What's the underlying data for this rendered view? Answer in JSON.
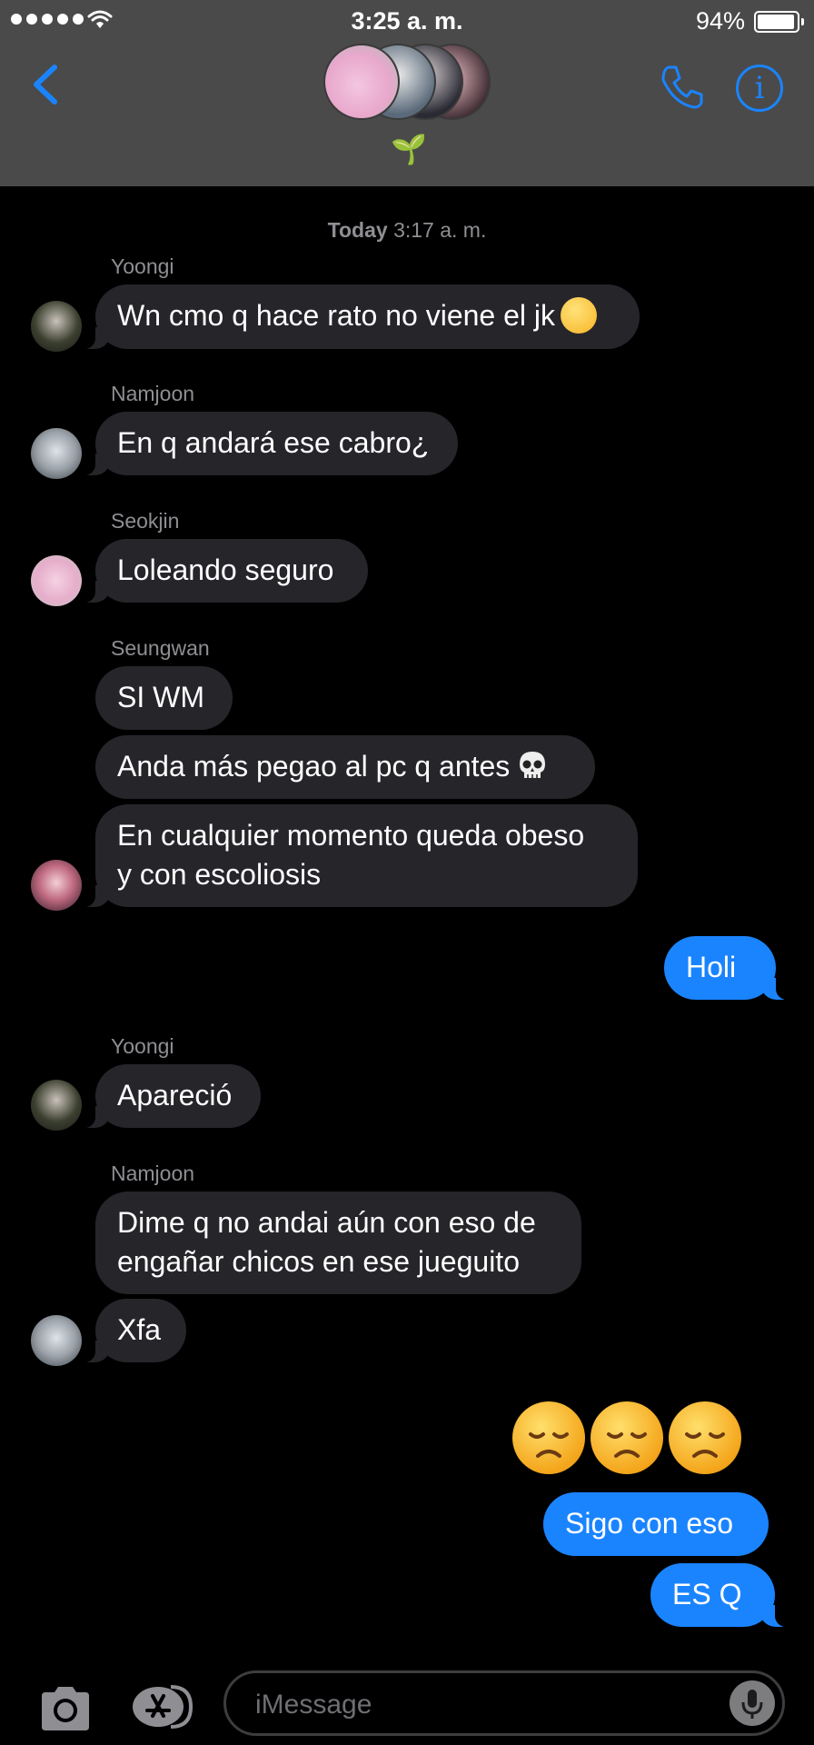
{
  "status_bar": {
    "time": "3:25 a. m.",
    "battery_percent": "94%",
    "battery_level": 0.94
  },
  "header": {
    "group_emoji": "🌱",
    "back_icon": "chevron-left-icon",
    "call_icon": "phone-icon",
    "info_icon": "info-icon",
    "accent_color": "#1a84ff"
  },
  "timestamp": {
    "day": "Today",
    "time": "3:17 a. m."
  },
  "messages": [
    {
      "sender": "Yoongi",
      "text": "Wn cmo q hace rato no viene el jk"
    },
    {
      "sender": "Namjoon",
      "text": "En q andará ese cabro¿"
    },
    {
      "sender": "Seokjin",
      "text": "Loleando seguro"
    },
    {
      "sender": "Seungwan",
      "texts": [
        "SI WM",
        "Anda más pegao al pc q antes",
        "En cualquier momento queda obeso",
        "y con escoliosis"
      ]
    },
    {
      "outgoing": true,
      "text": "Holi"
    },
    {
      "sender": "Yoongi",
      "text": "Apareció"
    },
    {
      "sender": "Namjoon",
      "texts": [
        "Dime q no andai aún con eso de",
        "engañar chicos en ese jueguito",
        "Xfa"
      ]
    },
    {
      "outgoing": true,
      "emojis": "😞😞😞",
      "texts": [
        "Sigo con eso",
        "ES Q"
      ]
    }
  ],
  "composer": {
    "placeholder": "iMessage",
    "camera_icon": "camera-icon",
    "apps_icon": "app-store-icon",
    "mic_icon": "microphone-icon"
  }
}
